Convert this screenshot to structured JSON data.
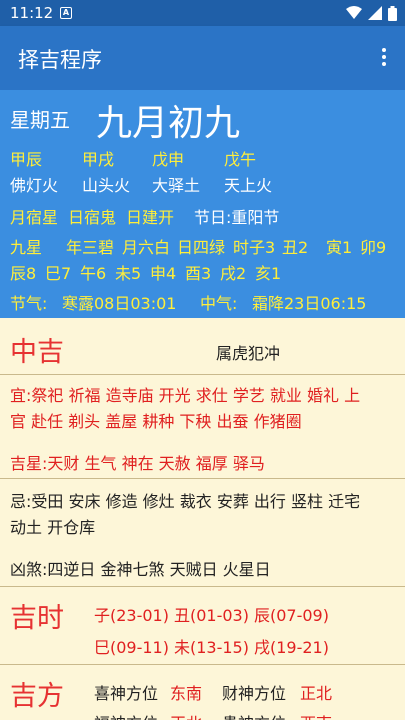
{
  "status": {
    "time": "11:12",
    "notification_icon": "A"
  },
  "app": {
    "title": "择吉程序"
  },
  "header": {
    "weekday": "星期五",
    "lunar_date": "九月初九"
  },
  "ganzhi": [
    "甲辰",
    "甲戌",
    "戊申",
    "戊午"
  ],
  "nayin": [
    "佛灯火",
    "山头火",
    "大驿土",
    "天上火"
  ],
  "row3": {
    "a": "月宿星",
    "b": "日宿鬼",
    "c": "日建开",
    "d": "节日:重阳节"
  },
  "jiuxing": {
    "label": "九星",
    "line1": [
      "年三碧",
      "月六白",
      "日四绿",
      "时子3",
      "丑2",
      "寅1",
      "卯9"
    ],
    "line2": [
      "辰8",
      "巳7",
      "午6",
      "未5",
      "申4",
      "酉3",
      "戌2",
      "亥1"
    ]
  },
  "jieqi": {
    "label": "节气:",
    "value": "寒露08日03:01",
    "label2": "中气:",
    "value2": "霜降23日06:15"
  },
  "rating": {
    "level": "中吉",
    "chong": "属虎犯冲"
  },
  "yi": {
    "label": "宜:",
    "line1": "祭祀 祈福 造寺庙 开光 求仕 学艺 就业 婚礼 上",
    "line2": "官 赴任 剃头 盖屋 耕种 下秧 出蚕 作猪圈"
  },
  "jixing": {
    "label": "吉星:",
    "value": "天财 生气 神在 天赦 福厚 驿马"
  },
  "ji": {
    "label": "忌:",
    "line1": "受田 安床 修造 修灶 裁衣 安葬 出行 竖柱 迁宅",
    "line2": "动土 开仓库"
  },
  "xiongsha": {
    "label": "凶煞:",
    "value": "四逆日 金神七煞 天贼日 火星日"
  },
  "jishi": {
    "title": "吉时",
    "row1": [
      "子(23-01)",
      "丑(01-03)",
      "辰(07-09)"
    ],
    "row2": [
      "巳(09-11)",
      "未(13-15)",
      "戌(19-21)"
    ]
  },
  "jifang": {
    "title": "吉方",
    "xi_label": "喜神方位",
    "xi": "东南",
    "cai_label": "财神方位",
    "cai": "正北",
    "fu_label": "福神方位",
    "fu": "正北",
    "gui_label": "贵神方位",
    "gui": "西南"
  }
}
